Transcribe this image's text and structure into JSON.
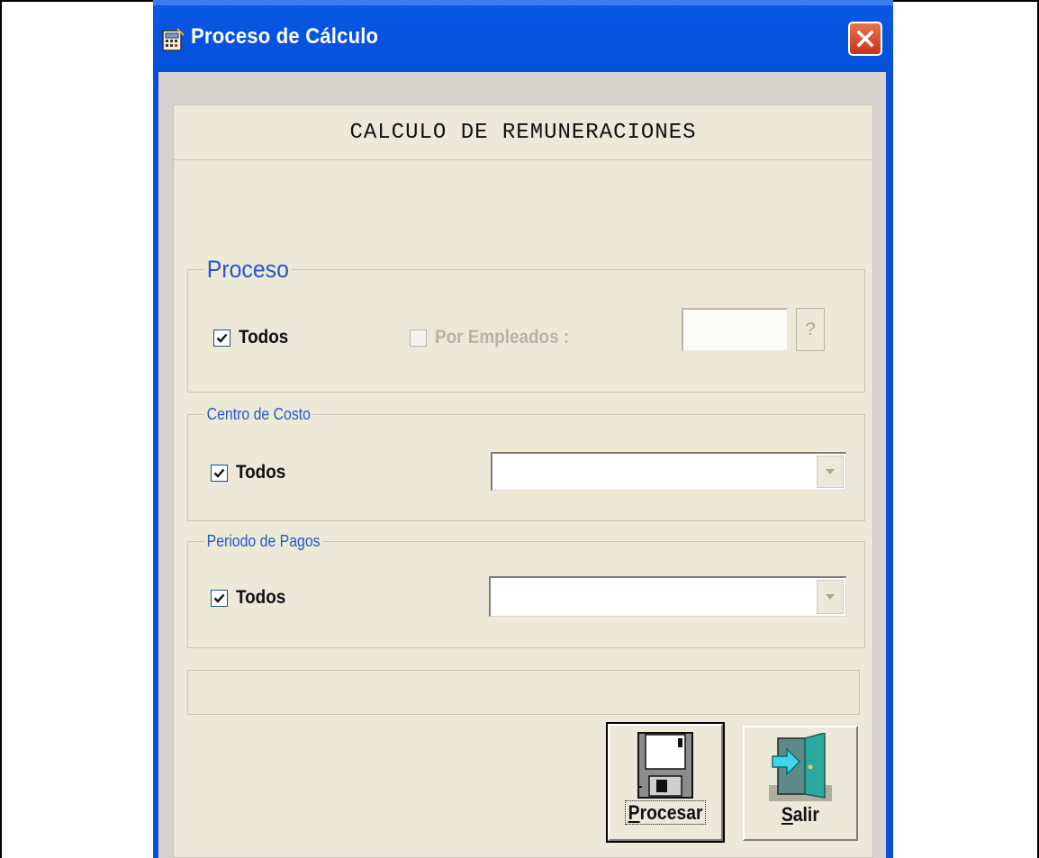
{
  "window": {
    "title": "Proceso de Cálculo",
    "icon": "calculator-app-icon"
  },
  "header": {
    "title": "CALCULO DE REMUNERACIONES"
  },
  "proceso": {
    "legend": "Proceso",
    "todos_label": "Todos",
    "todos_checked": true,
    "por_empleados_label": "Por Empleados :",
    "por_empleados_checked": false,
    "por_empleados_enabled": false,
    "employee_value": "",
    "lookup_label": "?"
  },
  "centro_costo": {
    "legend": "Centro de Costo",
    "todos_label": "Todos",
    "todos_checked": true,
    "selected_value": ""
  },
  "periodo_pagos": {
    "legend": "Periodo de Pagos",
    "todos_label": "Todos",
    "todos_checked": true,
    "selected_value": ""
  },
  "status": {
    "text": ""
  },
  "buttons": {
    "procesar_accel": "P",
    "procesar_rest": "rocesar",
    "salir_accel": "S",
    "salir_rest": "alir"
  },
  "colors": {
    "titlebar": "#0650d8",
    "legend_text": "#2a55c6",
    "dialog_bg": "#ece9d8",
    "close_button": "#d0492a"
  }
}
